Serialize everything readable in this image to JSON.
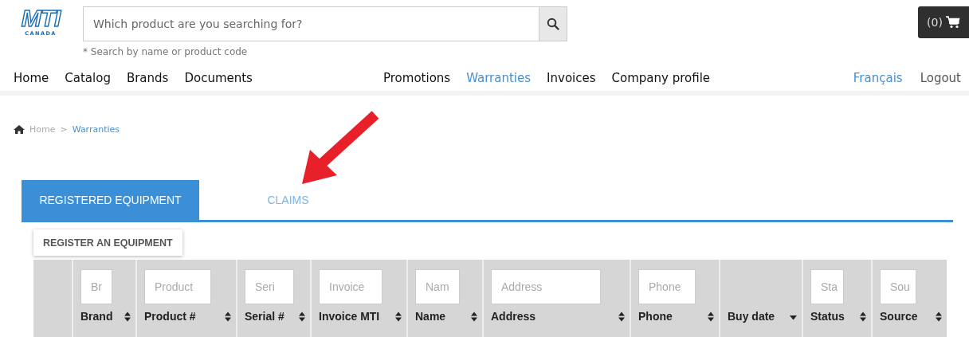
{
  "logo": {
    "mark": "MTI",
    "subtitle": "CANADA"
  },
  "search": {
    "placeholder": "Which product are you searching for?",
    "hint": "* Search by name or product code"
  },
  "cart": {
    "count": "(0)"
  },
  "nav": {
    "left": [
      {
        "label": "Home",
        "selected": false
      },
      {
        "label": "Catalog",
        "selected": false
      },
      {
        "label": "Brands",
        "selected": false
      },
      {
        "label": "Documents",
        "selected": false
      }
    ],
    "middle": [
      {
        "label": "Promotions",
        "selected": false
      },
      {
        "label": "Warranties",
        "selected": true
      },
      {
        "label": "Invoices",
        "selected": false
      },
      {
        "label": "Company profile",
        "selected": false
      }
    ],
    "language": "Français",
    "logout": "Logout"
  },
  "breadcrumb": [
    "Home",
    "Warranties"
  ],
  "breadcrumb_separator": ">",
  "tabs": [
    {
      "label": "REGISTERED EQUIPMENT",
      "selected": true
    },
    {
      "label": "CLAIMS",
      "selected": false
    }
  ],
  "register_button": "REGISTER AN EQUIPMENT",
  "table": {
    "columns": [
      {
        "label": "Brand",
        "placeholder": "Br",
        "kind": "sortable"
      },
      {
        "label": "Product #",
        "placeholder": "Product",
        "kind": "sortable"
      },
      {
        "label": "Serial #",
        "placeholder": "Seri",
        "kind": "sortable"
      },
      {
        "label": "Invoice MTI",
        "placeholder": "Invoice",
        "kind": "sortable"
      },
      {
        "label": "Name",
        "placeholder": "Nam",
        "kind": "sortable"
      },
      {
        "label": "Address",
        "placeholder": "Address",
        "kind": "sortable"
      },
      {
        "label": "Phone",
        "placeholder": "Phone",
        "kind": "sortable"
      },
      {
        "label": "Buy date",
        "kind": "descending"
      },
      {
        "label": "Status",
        "placeholder": "Sta",
        "kind": "sortable"
      },
      {
        "label": "Source",
        "placeholder": "Sou",
        "kind": "sortable"
      }
    ]
  }
}
